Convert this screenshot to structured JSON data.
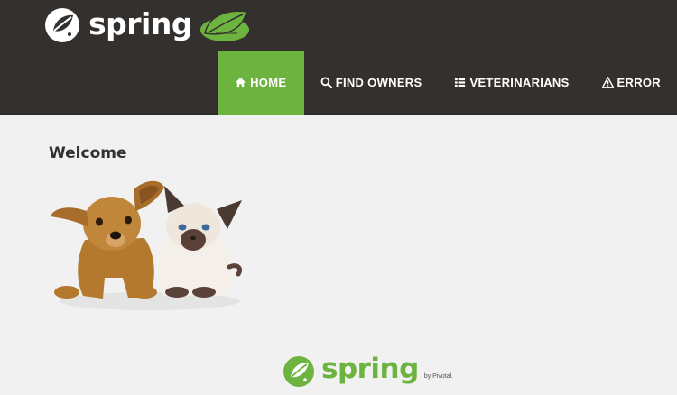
{
  "brand": {
    "name": "spring",
    "leaf_icon": "petclinic-leaf-icon"
  },
  "nav": {
    "items": [
      {
        "label": "HOME",
        "icon": "home-icon",
        "active": true
      },
      {
        "label": "FIND OWNERS",
        "icon": "search-icon",
        "active": false
      },
      {
        "label": "VETERINARIANS",
        "icon": "list-icon",
        "active": false
      },
      {
        "label": "ERROR",
        "icon": "warning-icon",
        "active": false
      }
    ]
  },
  "main": {
    "title": "Welcome",
    "image": "pets-photo"
  },
  "footer": {
    "brand": "spring",
    "by": "by Pivotal."
  },
  "colors": {
    "navbar": "#34302d",
    "accent": "#6db33f",
    "background": "#f1f1f1"
  }
}
